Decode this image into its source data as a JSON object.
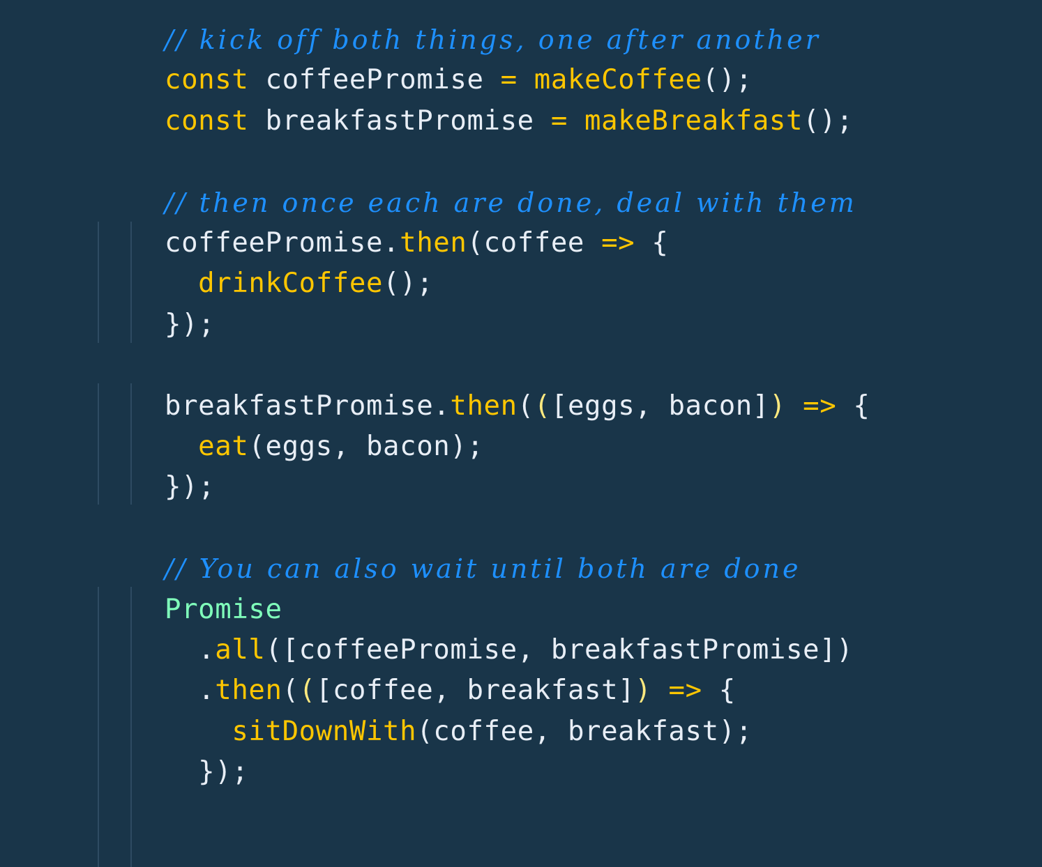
{
  "editor": {
    "theme_colors": {
      "background": "#193549",
      "comment": "#1e90ff",
      "keyword": "#ffc600",
      "function": "#ffc600",
      "text": "#e8eef6",
      "class": "#80ffbb",
      "indent_guide": "#2e4b62"
    },
    "lines": [
      {
        "tokens": [
          {
            "t": "// kick off both things, one after another",
            "c": "comment"
          }
        ]
      },
      {
        "tokens": [
          {
            "t": "const",
            "c": "kw"
          },
          {
            "t": " coffeePromise ",
            "c": "plain"
          },
          {
            "t": "=",
            "c": "op"
          },
          {
            "t": " ",
            "c": "plain"
          },
          {
            "t": "makeCoffee",
            "c": "fn"
          },
          {
            "t": "();",
            "c": "plain"
          }
        ]
      },
      {
        "tokens": [
          {
            "t": "const",
            "c": "kw"
          },
          {
            "t": " breakfastPromise ",
            "c": "plain"
          },
          {
            "t": "=",
            "c": "op"
          },
          {
            "t": " ",
            "c": "plain"
          },
          {
            "t": "makeBreakfast",
            "c": "fn"
          },
          {
            "t": "();",
            "c": "plain"
          }
        ]
      },
      {
        "tokens": []
      },
      {
        "tokens": [
          {
            "t": "// then once each are done, deal with them",
            "c": "comment"
          }
        ]
      },
      {
        "tokens": [
          {
            "t": "coffeePromise.",
            "c": "plain"
          },
          {
            "t": "then",
            "c": "fn"
          },
          {
            "t": "(coffee ",
            "c": "plain"
          },
          {
            "t": "=>",
            "c": "op"
          },
          {
            "t": " {",
            "c": "plain"
          }
        ]
      },
      {
        "tokens": [
          {
            "t": "  ",
            "c": "plain"
          },
          {
            "t": "drinkCoffee",
            "c": "fn"
          },
          {
            "t": "();",
            "c": "plain"
          }
        ]
      },
      {
        "tokens": [
          {
            "t": "});",
            "c": "plain"
          }
        ]
      },
      {
        "tokens": []
      },
      {
        "tokens": [
          {
            "t": "breakfastPromise.",
            "c": "plain"
          },
          {
            "t": "then",
            "c": "fn"
          },
          {
            "t": "(",
            "c": "plain"
          },
          {
            "t": "(",
            "c": "paren2"
          },
          {
            "t": "[eggs, bacon]",
            "c": "plain"
          },
          {
            "t": ")",
            "c": "paren2"
          },
          {
            "t": " ",
            "c": "plain"
          },
          {
            "t": "=>",
            "c": "op"
          },
          {
            "t": " {",
            "c": "plain"
          }
        ]
      },
      {
        "tokens": [
          {
            "t": "  ",
            "c": "plain"
          },
          {
            "t": "eat",
            "c": "fn"
          },
          {
            "t": "(eggs, bacon);",
            "c": "plain"
          }
        ]
      },
      {
        "tokens": [
          {
            "t": "});",
            "c": "plain"
          }
        ]
      },
      {
        "tokens": []
      },
      {
        "tokens": [
          {
            "t": "// You can also wait until both are done",
            "c": "comment"
          }
        ]
      },
      {
        "tokens": [
          {
            "t": "Promise",
            "c": "cls"
          }
        ]
      },
      {
        "tokens": [
          {
            "t": "  .",
            "c": "plain"
          },
          {
            "t": "all",
            "c": "fn"
          },
          {
            "t": "([coffeePromise, breakfastPromise])",
            "c": "plain"
          }
        ]
      },
      {
        "tokens": [
          {
            "t": "  .",
            "c": "plain"
          },
          {
            "t": "then",
            "c": "fn"
          },
          {
            "t": "(",
            "c": "plain"
          },
          {
            "t": "(",
            "c": "paren2"
          },
          {
            "t": "[coffee, breakfast]",
            "c": "plain"
          },
          {
            "t": ")",
            "c": "paren2"
          },
          {
            "t": " ",
            "c": "plain"
          },
          {
            "t": "=>",
            "c": "op"
          },
          {
            "t": " {",
            "c": "plain"
          }
        ]
      },
      {
        "tokens": [
          {
            "t": "    ",
            "c": "plain"
          },
          {
            "t": "sitDownWith",
            "c": "fn"
          },
          {
            "t": "(coffee, breakfast);",
            "c": "plain"
          }
        ]
      },
      {
        "tokens": [
          {
            "t": "  });",
            "c": "plain"
          }
        ]
      }
    ]
  }
}
